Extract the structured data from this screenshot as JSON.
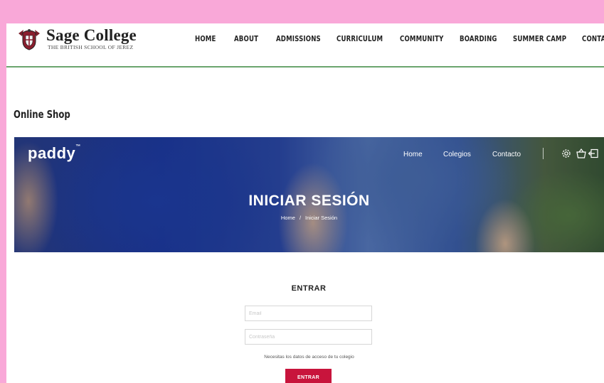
{
  "site": {
    "logo_title": "Sage College",
    "logo_subtitle": "THE BRITISH SCHOOL OF JEREZ"
  },
  "nav": {
    "items": [
      "HOME",
      "ABOUT",
      "ADMISSIONS",
      "CURRICULUM",
      "COMMUNITY",
      "BOARDING",
      "SUMMER CAMP",
      "CONTA"
    ]
  },
  "page": {
    "title": "Online Shop"
  },
  "embed": {
    "brand": "paddy",
    "brand_mark": "™",
    "nav": [
      "Home",
      "Colegios",
      "Contacto"
    ],
    "icons": [
      "gear-icon",
      "shop-basket-icon",
      "logout-icon"
    ],
    "hero_title": "INICIAR SESIÓN",
    "breadcrumb": [
      "Home",
      "Iniciar Sesión"
    ],
    "breadcrumb_separator": "/"
  },
  "login": {
    "heading": "ENTRAR",
    "email_placeholder": "Email",
    "password_placeholder": "Contraseña",
    "help_text": "Necesitas los datos de acceso de tu colegio",
    "submit_label": "ENTRAR"
  },
  "colors": {
    "page_background": "#f9a8d8",
    "header_rule": "#6aa56e",
    "submit_button": "#c8143c"
  }
}
